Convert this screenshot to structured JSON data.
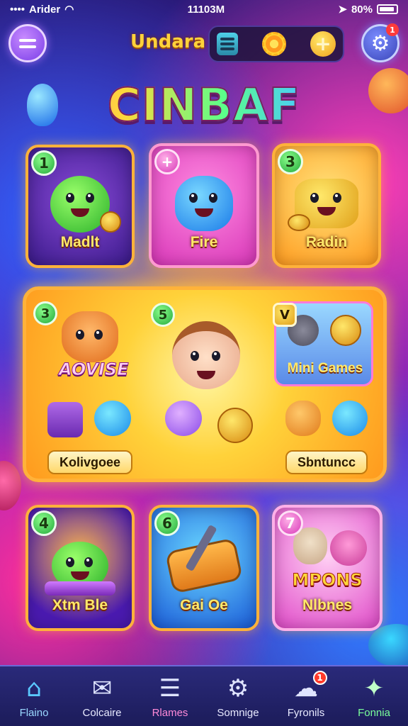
{
  "status_bar": {
    "carrier": "Arider",
    "time": "11103M",
    "battery": "80%"
  },
  "header": {
    "game_name": "Undara",
    "settings_badge": "1"
  },
  "logo": "CINBAF",
  "tiles": [
    {
      "number": "1",
      "label": "Madlt"
    },
    {
      "number": "+",
      "label": "Fire"
    },
    {
      "number": "3",
      "label": "Radin"
    },
    {
      "number": "4",
      "label": "Xtm Ble"
    },
    {
      "number": "6",
      "label": "Gai Oe"
    },
    {
      "number": "7",
      "label": "Nlbnes"
    }
  ],
  "featured": {
    "num_left": "3",
    "num_center": "5",
    "num_mini": "V",
    "adventure_label": "AOVISE",
    "mini_games_label": "Mini Games",
    "bottom_left_plate": "Kolivgoee",
    "bottom_right_plate": "Sbntuncc"
  },
  "tile6_banner": "MPONS",
  "bottom_nav": [
    {
      "label": "Flaino",
      "icon": "home-icon",
      "active": true
    },
    {
      "label": "Colcaire",
      "icon": "chat-icon"
    },
    {
      "label": "Rlames",
      "icon": "list-icon"
    },
    {
      "label": "Somnige",
      "icon": "gear-icon"
    },
    {
      "label": "Fyronils",
      "icon": "ghost-icon",
      "badge": "1"
    },
    {
      "label": "Fonnia",
      "icon": "puzzle-icon"
    }
  ]
}
